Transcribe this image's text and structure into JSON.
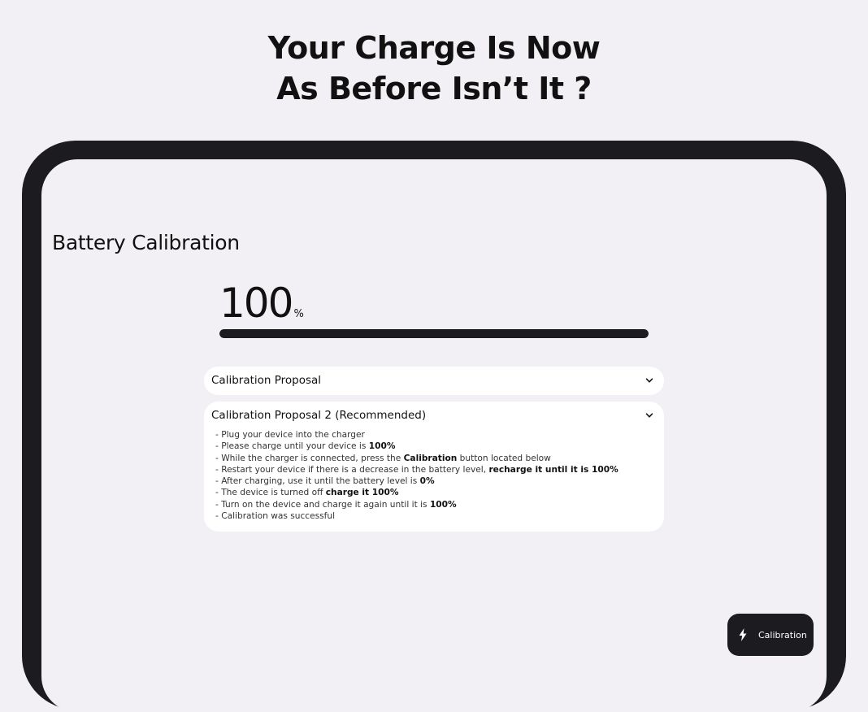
{
  "headline": {
    "line1": "Your Charge Is Now",
    "line2": "As Before Isn’t It ?"
  },
  "app": {
    "title": "Battery Calibration",
    "battery_value": "100",
    "battery_unit": "%",
    "battery_level_fraction": 1.0
  },
  "cards": [
    {
      "title": "Calibration Proposal",
      "expanded": false
    },
    {
      "title": "Calibration Proposal 2 (Recommended)",
      "expanded": true,
      "steps": [
        {
          "prefix": "- Plug your device into the charger",
          "bold": "",
          "suffix": ""
        },
        {
          "prefix": "- Please charge until your device is ",
          "bold": "100%",
          "suffix": ""
        },
        {
          "prefix": "- While the charger is connected, press the ",
          "bold": "Calibration",
          "suffix": " button located below"
        },
        {
          "prefix": "- Restart your device if there is a decrease in the battery level, ",
          "bold": "recharge it until it is 100%",
          "suffix": ""
        },
        {
          "prefix": "- After charging, use it until the battery level is ",
          "bold": "0%",
          "suffix": ""
        },
        {
          "prefix": "- The device is turned off ",
          "bold": "charge it 100%",
          "suffix": ""
        },
        {
          "prefix": "- Turn on the device and charge it again until it is ",
          "bold": "100%",
          "suffix": ""
        },
        {
          "prefix": "- Calibration was successful",
          "bold": "",
          "suffix": ""
        }
      ]
    }
  ],
  "fab": {
    "label": "Calibration",
    "icon": "bolt-icon"
  },
  "colors": {
    "background": "#f2f0f4",
    "frame": "#1c1b1f",
    "card": "#ffffff",
    "accent": "#1c1b1f"
  }
}
